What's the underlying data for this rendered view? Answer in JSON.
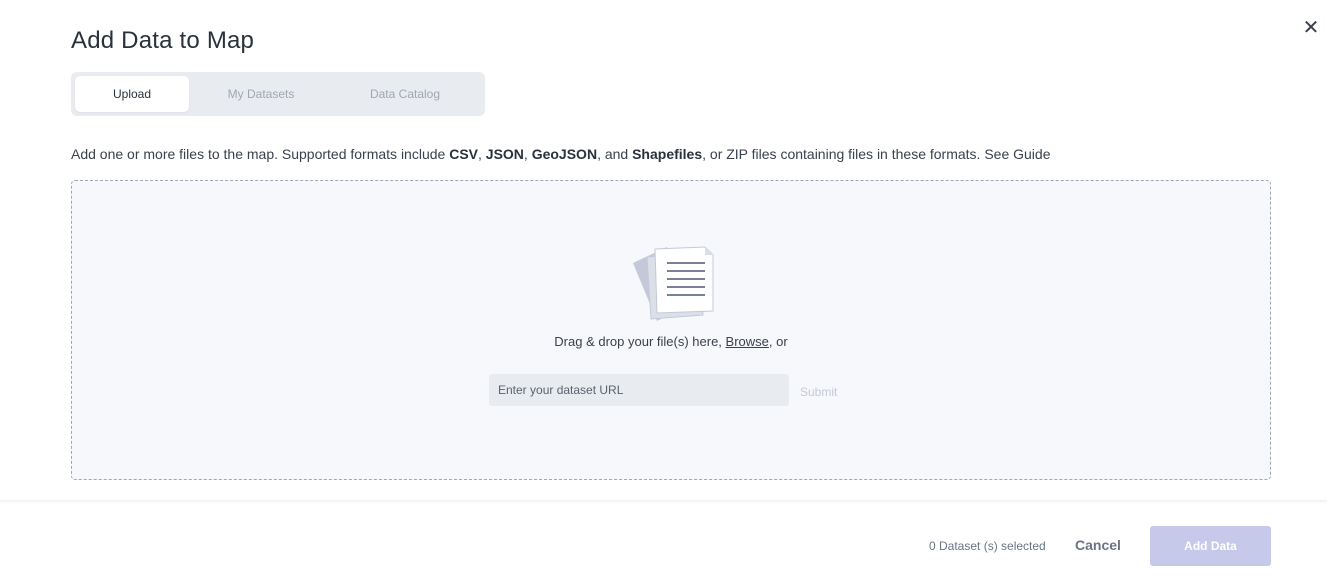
{
  "modal": {
    "title": "Add Data to Map",
    "close_icon": "close-icon"
  },
  "tabs": [
    {
      "label": "Upload",
      "active": true
    },
    {
      "label": "My Datasets",
      "active": false
    },
    {
      "label": "Data Catalog",
      "active": false
    }
  ],
  "description": {
    "prefix": "Add one or more files to the map. Supported formats include ",
    "format_1": "CSV",
    "sep_1": ", ",
    "format_2": "JSON",
    "sep_2": ", ",
    "format_3": "GeoJSON",
    "sep_3": ", and ",
    "format_4": "Shapefiles",
    "suffix": ", or ZIP files containing files in these formats. See Guide"
  },
  "dropzone": {
    "icon": "document-stack-icon",
    "drag_text": "Drag & drop your file(s) here, ",
    "browse_label": "Browse",
    "or_text": ", or",
    "url_placeholder": "Enter your dataset URL",
    "submit_label": "Submit"
  },
  "footer": {
    "selected_count": "0 Dataset (s) selected",
    "cancel_label": "Cancel",
    "add_label": "Add Data"
  },
  "colors": {
    "tab_bg": "#e8ebf0",
    "dropzone_bg": "#f7f8fb",
    "primary_disabled": "#c7c9ea",
    "text": "#29323c"
  }
}
